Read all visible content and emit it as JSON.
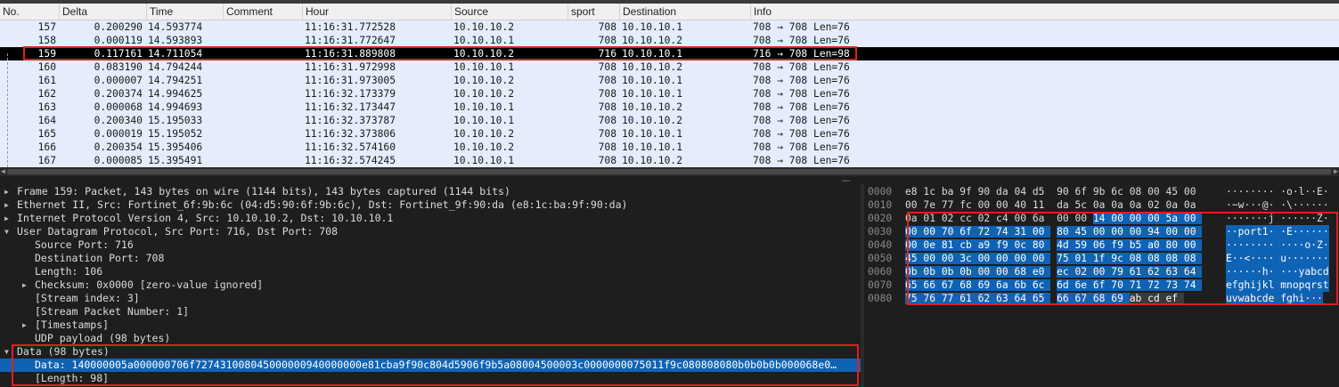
{
  "columns": [
    "No.",
    "Delta",
    "Time",
    "Comment",
    "Hour",
    "Source",
    "sport",
    "Destination",
    "Info"
  ],
  "packets": [
    {
      "no": "157",
      "delta": "0.200290",
      "time": "14.593774",
      "hour": "11:16:31.772528",
      "src": "10.10.10.2",
      "sport": "708",
      "dst": "10.10.10.1",
      "info": "708 → 708 Len=76"
    },
    {
      "no": "158",
      "delta": "0.000119",
      "time": "14.593893",
      "hour": "11:16:31.772647",
      "src": "10.10.10.1",
      "sport": "708",
      "dst": "10.10.10.2",
      "info": "708 → 708 Len=76"
    },
    {
      "no": "159",
      "delta": "0.117161",
      "time": "14.711054",
      "hour": "11:16:31.889808",
      "src": "10.10.10.2",
      "sport": "716",
      "dst": "10.10.10.1",
      "info": "716 → 708 Len=98",
      "selected": true
    },
    {
      "no": "160",
      "delta": "0.083190",
      "time": "14.794244",
      "hour": "11:16:31.972998",
      "src": "10.10.10.1",
      "sport": "708",
      "dst": "10.10.10.2",
      "info": "708 → 708 Len=76"
    },
    {
      "no": "161",
      "delta": "0.000007",
      "time": "14.794251",
      "hour": "11:16:31.973005",
      "src": "10.10.10.2",
      "sport": "708",
      "dst": "10.10.10.1",
      "info": "708 → 708 Len=76"
    },
    {
      "no": "162",
      "delta": "0.200374",
      "time": "14.994625",
      "hour": "11:16:32.173379",
      "src": "10.10.10.2",
      "sport": "708",
      "dst": "10.10.10.1",
      "info": "708 → 708 Len=76"
    },
    {
      "no": "163",
      "delta": "0.000068",
      "time": "14.994693",
      "hour": "11:16:32.173447",
      "src": "10.10.10.1",
      "sport": "708",
      "dst": "10.10.10.2",
      "info": "708 → 708 Len=76"
    },
    {
      "no": "164",
      "delta": "0.200340",
      "time": "15.195033",
      "hour": "11:16:32.373787",
      "src": "10.10.10.1",
      "sport": "708",
      "dst": "10.10.10.2",
      "info": "708 → 708 Len=76"
    },
    {
      "no": "165",
      "delta": "0.000019",
      "time": "15.195052",
      "hour": "11:16:32.373806",
      "src": "10.10.10.2",
      "sport": "708",
      "dst": "10.10.10.1",
      "info": "708 → 708 Len=76"
    },
    {
      "no": "166",
      "delta": "0.200354",
      "time": "15.395406",
      "hour": "11:16:32.574160",
      "src": "10.10.10.2",
      "sport": "708",
      "dst": "10.10.10.1",
      "info": "708 → 708 Len=76"
    },
    {
      "no": "167",
      "delta": "0.000085",
      "time": "15.395491",
      "hour": "11:16:32.574245",
      "src": "10.10.10.1",
      "sport": "708",
      "dst": "10.10.10.2",
      "info": "708 → 708 Len=76"
    }
  ],
  "details": [
    {
      "text": "Frame 159: Packet, 143 bytes on wire (1144 bits), 143 bytes captured (1144 bits)",
      "indent": 0,
      "arrow": "collapsed"
    },
    {
      "text": "Ethernet II, Src: Fortinet_6f:9b:6c (04:d5:90:6f:9b:6c), Dst: Fortinet_9f:90:da (e8:1c:ba:9f:90:da)",
      "indent": 0,
      "arrow": "collapsed"
    },
    {
      "text": "Internet Protocol Version 4, Src: 10.10.10.2, Dst: 10.10.10.1",
      "indent": 0,
      "arrow": "collapsed"
    },
    {
      "text": "User Datagram Protocol, Src Port: 716, Dst Port: 708",
      "indent": 0,
      "arrow": "expanded"
    },
    {
      "text": "Source Port: 716",
      "indent": 1,
      "arrow": "none"
    },
    {
      "text": "Destination Port: 708",
      "indent": 1,
      "arrow": "none"
    },
    {
      "text": "Length: 106",
      "indent": 1,
      "arrow": "none"
    },
    {
      "text": "Checksum: 0x0000 [zero-value ignored]",
      "indent": 1,
      "arrow": "collapsed"
    },
    {
      "text": "[Stream index: 3]",
      "indent": 1,
      "arrow": "none"
    },
    {
      "text": "[Stream Packet Number: 1]",
      "indent": 1,
      "arrow": "none"
    },
    {
      "text": "[Timestamps]",
      "indent": 1,
      "arrow": "collapsed"
    },
    {
      "text": "UDP payload (98 bytes)",
      "indent": 1,
      "arrow": "none"
    },
    {
      "text": "Data (98 bytes)",
      "indent": 0,
      "arrow": "expanded"
    },
    {
      "text": "Data: 140000005a000000706f727431008045000000940000000e81cba9f90c804d5906f9b5a08004500003c0000000075011f9c080808080b0b0b0b000068e0…",
      "indent": 1,
      "arrow": "none",
      "selected": true
    },
    {
      "text": "[Length: 98]",
      "indent": 1,
      "arrow": "none"
    }
  ],
  "bytes": [
    {
      "offset": "0000",
      "hex": "e8 1c ba 9f 90 da 04 d5  90 6f 9b 6c 08 00 45 00",
      "ascii": "········ ·o·l··E·",
      "hl_from": 16
    },
    {
      "offset": "0010",
      "hex": "00 7e 77 fc 00 00 40 11  da 5c 0a 0a 0a 02 0a 0a",
      "ascii": "·~w···@· ·\\······",
      "hl_from": 16
    },
    {
      "offset": "0020",
      "hex": "0a 01 02 cc 02 c4 00 6a  00 00 14 00 00 00 5a 00",
      "ascii": "·······j ······Z·",
      "hl_from": 10
    },
    {
      "offset": "0030",
      "hex": "00 00 70 6f 72 74 31 00  80 45 00 00 00 94 00 00",
      "ascii": "··port1· ·E······",
      "hl_from": 0
    },
    {
      "offset": "0040",
      "hex": "00 0e 81 cb a9 f9 0c 80  4d 59 06 f9 b5 a0 80 00",
      "ascii": "········ ····o·Z·",
      "hl_from": 0
    },
    {
      "offset": "0050",
      "hex": "45 00 00 3c 00 00 00 00  75 01 1f 9c 08 08 08 08",
      "ascii": "E··<···· u·······",
      "hl_from": 0
    },
    {
      "offset": "0060",
      "hex": "0b 0b 0b 0b 00 00 68 e0  ec 02 00 79 61 62 63 64",
      "ascii": "······h· ···yabcd",
      "hl_from": 0
    },
    {
      "offset": "0070",
      "hex": "65 66 67 68 69 6a 6b 6c  6d 6e 6f 70 71 72 73 74",
      "ascii": "efghijkl mnopqrst",
      "hl_from": 0
    },
    {
      "offset": "0080",
      "hex": "75 76 77 61 62 63 64 65  66 67 68 69 ab cd ef",
      "ascii": "uvwabcde fghi···",
      "hl_from": 0,
      "hl_to": 12
    }
  ]
}
